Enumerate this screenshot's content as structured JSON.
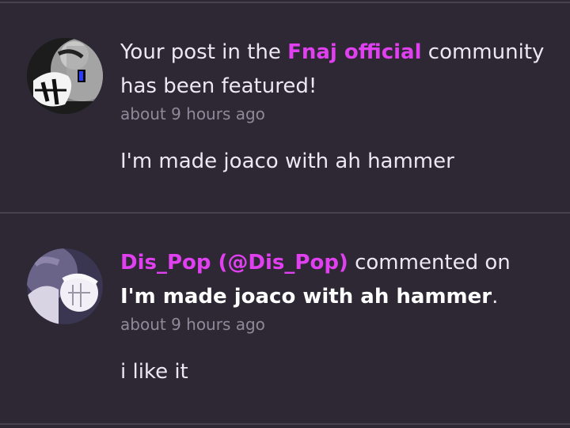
{
  "notifications": [
    {
      "prefix": "Your post in the ",
      "community_name": "Fnaj official",
      "suffix": " community has been featured!",
      "time": "about 9 hours ago",
      "content": "I'm made joaco with ah hammer"
    },
    {
      "user": "Dis_Pop (@Dis_Pop)",
      "action": " commented on ",
      "post_title": "I'm made joaco with ah hammer",
      "period": ".",
      "time": "about 9 hours ago",
      "content": "i like it"
    }
  ],
  "colors": {
    "background": "#2d2834",
    "accent": "#e040f0",
    "text": "#ece8f2",
    "muted": "#8f8a99",
    "divider": "#474250"
  }
}
